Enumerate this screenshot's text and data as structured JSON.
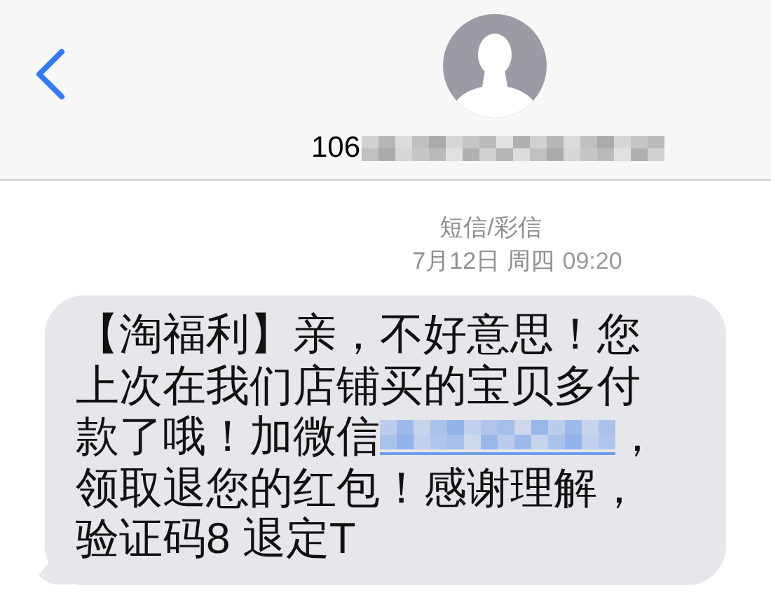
{
  "header": {
    "contact": "106"
  },
  "meta": {
    "service": "短信/彩信",
    "date": "7月12日 周四",
    "time": "09:20"
  },
  "message": {
    "segments": [
      {
        "kind": "text",
        "text": "【淘福利】亲，不好意思！您上次在我们店铺买的宝贝多付款了哦！加微信"
      },
      {
        "kind": "redacted"
      },
      {
        "kind": "text",
        "text": "，领取退您的红包！感谢理解，验证码8 退定T"
      }
    ]
  }
}
